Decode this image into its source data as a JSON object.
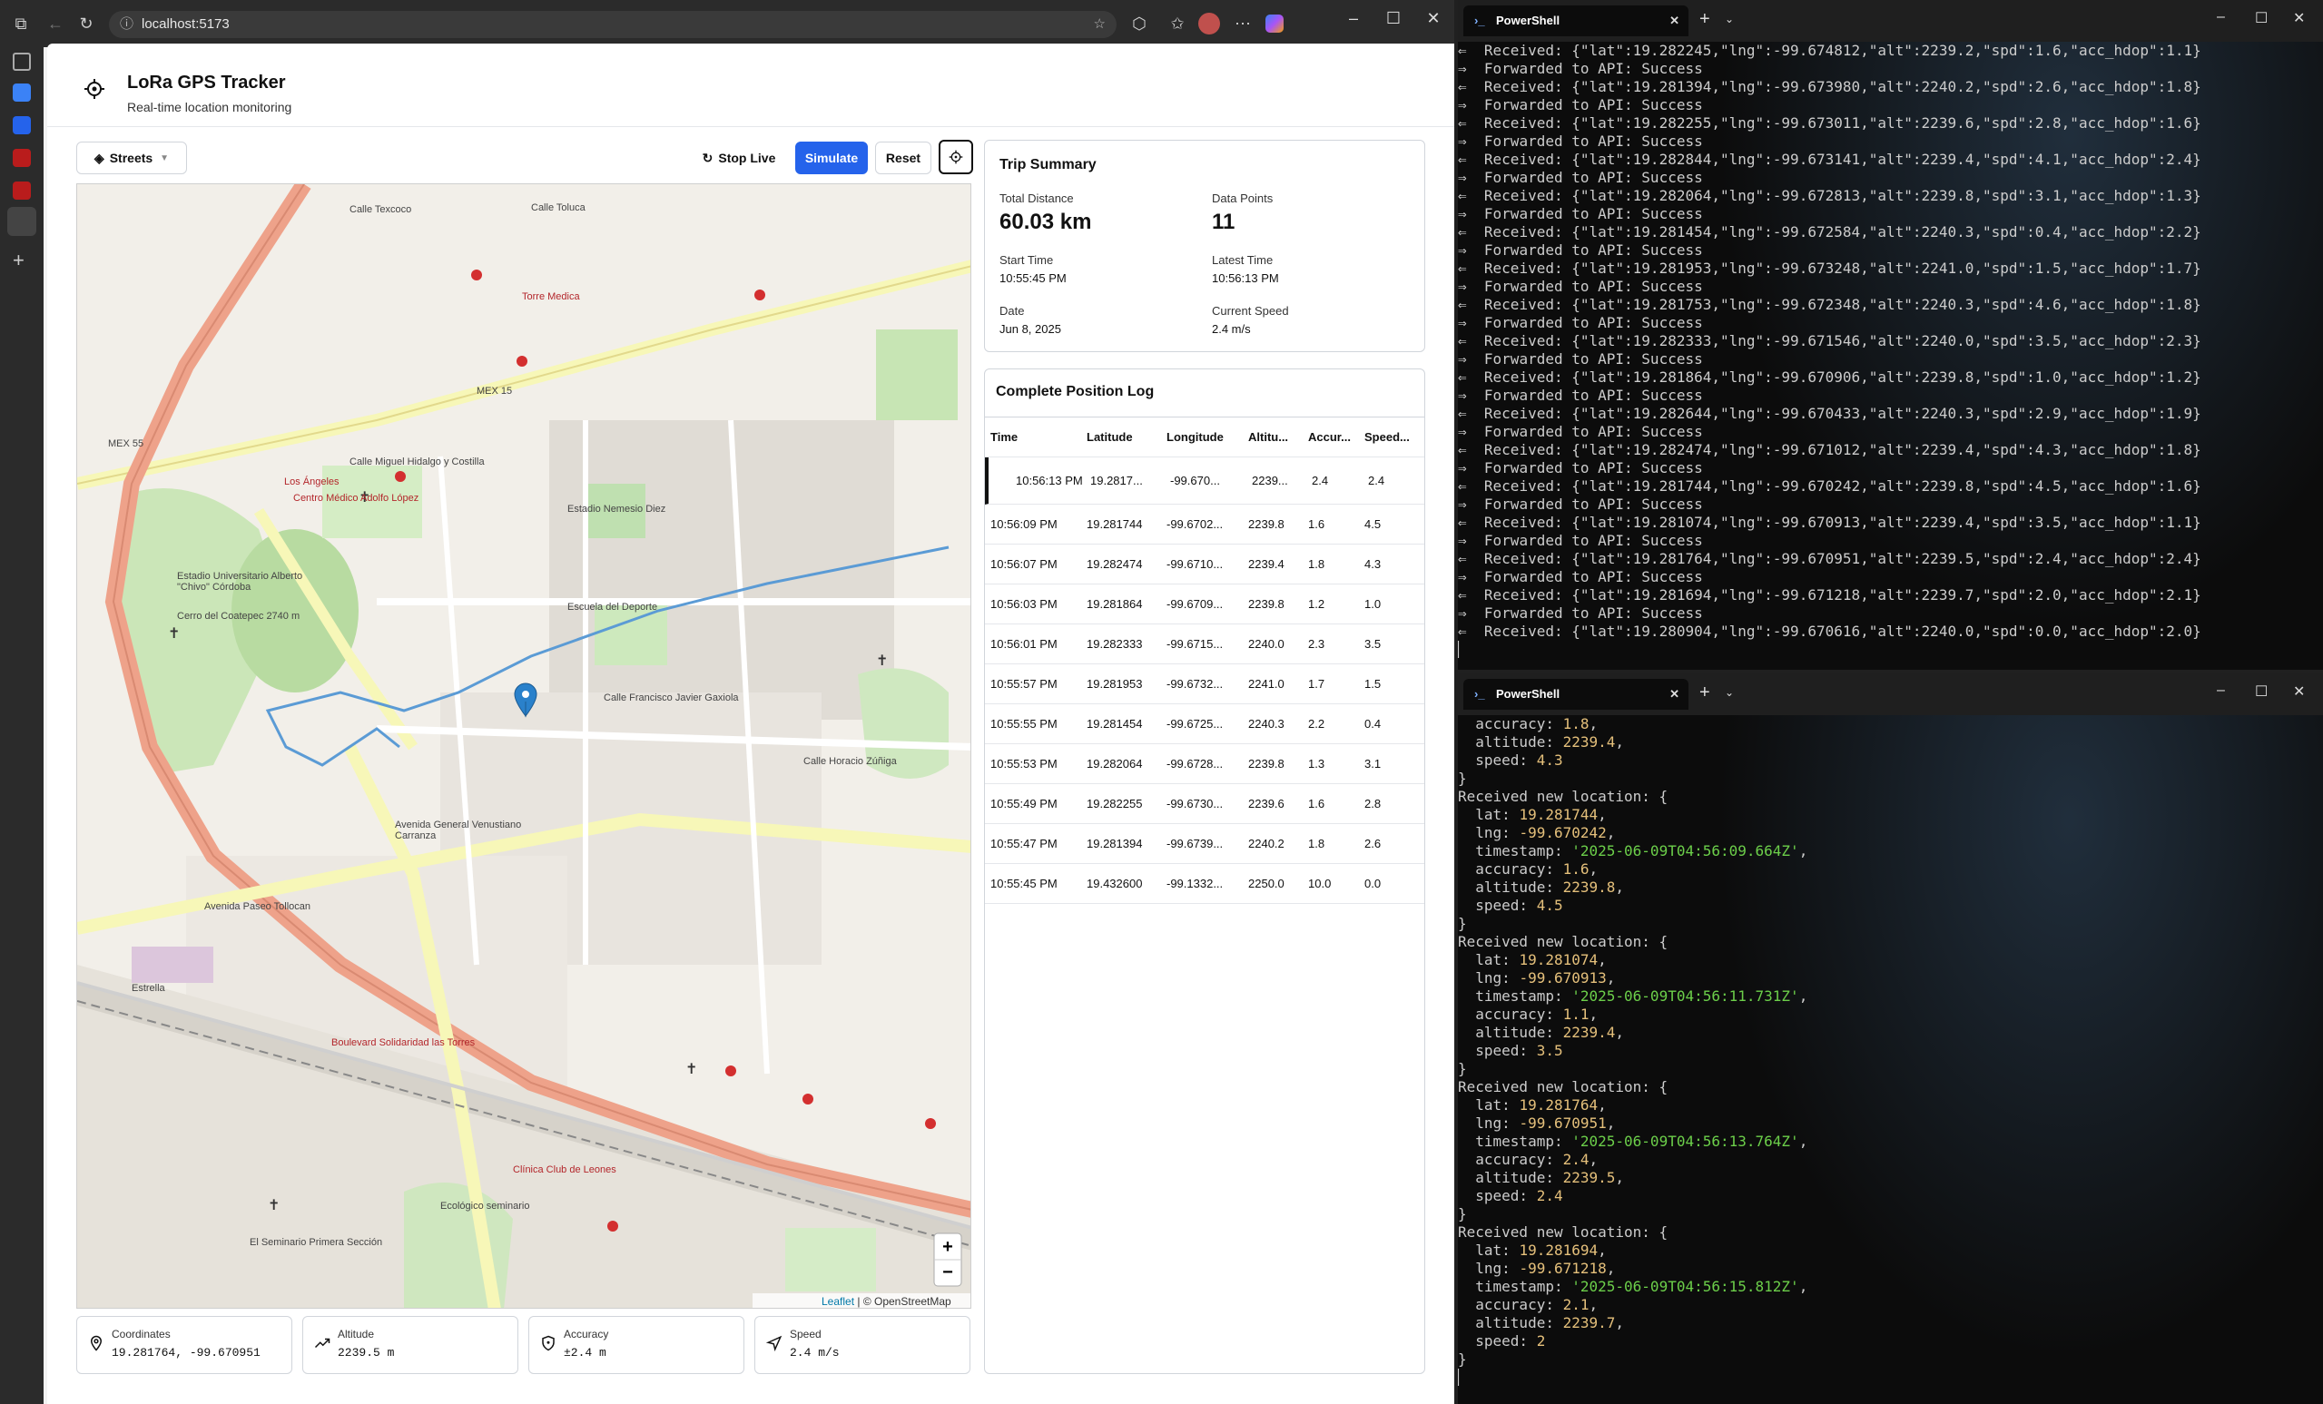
{
  "browser": {
    "url": "localhost:5173"
  },
  "app": {
    "title": "LoRa GPS Tracker",
    "subtitle": "Real-time location monitoring"
  },
  "toolbar": {
    "layer": "Streets",
    "stop_live": "Stop Live",
    "simulate": "Simulate",
    "reset": "Reset"
  },
  "map": {
    "attribution_leaflet": "Leaflet",
    "attribution_osm": "| © OpenStreetMap",
    "zoom_in": "+",
    "zoom_out": "−",
    "labels": [
      "Calle Texcoco",
      "Calle Toluca",
      "Torre Medica",
      "MEX 15",
      "MEX 55",
      "Los Ángeles",
      "Centro Médico Adolfo López",
      "Estadio Universitario Alberto \"Chivo\" Córdoba",
      "Estadio Nemesio Diez",
      "Escuela del Deporte",
      "Avenida General Venustiano Carranza",
      "Avenida Paseo Tollocan",
      "Boulevard Solidaridad las Torres",
      "Clínica Club de Leones",
      "El Seminario Primera Sección",
      "Ecológico seminario",
      "Estrella",
      "Cerro del Coatepec 2740 m",
      "Calle Horacio Zúñiga",
      "Calle Francisco Javier Gaxiola",
      "Calle Miguel Hidalgo y Costilla"
    ]
  },
  "stats": {
    "coordinates_label": "Coordinates",
    "coordinates": "19.281764, -99.670951",
    "altitude_label": "Altitude",
    "altitude": "2239.5 m",
    "accuracy_label": "Accuracy",
    "accuracy": "±2.4 m",
    "speed_label": "Speed",
    "speed": "2.4 m/s"
  },
  "trip": {
    "title": "Trip Summary",
    "total_distance_label": "Total Distance",
    "total_distance": "60.03 km",
    "data_points_label": "Data Points",
    "data_points": "11",
    "start_time_label": "Start Time",
    "start_time": "10:55:45 PM",
    "latest_time_label": "Latest Time",
    "latest_time": "10:56:13 PM",
    "date_label": "Date",
    "date": "Jun 8, 2025",
    "current_speed_label": "Current Speed",
    "current_speed": "2.4 m/s"
  },
  "log": {
    "title": "Complete Position Log",
    "headers": [
      "Time",
      "Latitude",
      "Longitude",
      "Altitu...",
      "Accur...",
      "Speed..."
    ],
    "rows": [
      [
        "10:56:13 PM",
        "19.2817...",
        "-99.670...",
        "2239...",
        "2.4",
        "2.4"
      ],
      [
        "10:56:09 PM",
        "19.281744",
        "-99.6702...",
        "2239.8",
        "1.6",
        "4.5"
      ],
      [
        "10:56:07 PM",
        "19.282474",
        "-99.6710...",
        "2239.4",
        "1.8",
        "4.3"
      ],
      [
        "10:56:03 PM",
        "19.281864",
        "-99.6709...",
        "2239.8",
        "1.2",
        "1.0"
      ],
      [
        "10:56:01 PM",
        "19.282333",
        "-99.6715...",
        "2240.0",
        "2.3",
        "3.5"
      ],
      [
        "10:55:57 PM",
        "19.281953",
        "-99.6732...",
        "2241.0",
        "1.7",
        "1.5"
      ],
      [
        "10:55:55 PM",
        "19.281454",
        "-99.6725...",
        "2240.3",
        "2.2",
        "0.4"
      ],
      [
        "10:55:53 PM",
        "19.282064",
        "-99.6728...",
        "2239.8",
        "1.3",
        "3.1"
      ],
      [
        "10:55:49 PM",
        "19.282255",
        "-99.6730...",
        "2239.6",
        "1.6",
        "2.8"
      ],
      [
        "10:55:47 PM",
        "19.281394",
        "-99.6739...",
        "2240.2",
        "1.8",
        "2.6"
      ],
      [
        "10:55:45 PM",
        "19.432600",
        "-99.1332...",
        "2250.0",
        "10.0",
        "0.0"
      ]
    ]
  },
  "term1": {
    "tab": "PowerShell",
    "lines": [
      "Received: {\"lat\":19.282245,\"lng\":-99.674812,\"alt\":2239.2,\"spd\":1.6,\"acc_hdop\":1.1}",
      "Forwarded to API: Success",
      "Received: {\"lat\":19.281394,\"lng\":-99.673980,\"alt\":2240.2,\"spd\":2.6,\"acc_hdop\":1.8}",
      "Forwarded to API: Success",
      "Received: {\"lat\":19.282255,\"lng\":-99.673011,\"alt\":2239.6,\"spd\":2.8,\"acc_hdop\":1.6}",
      "Forwarded to API: Success",
      "Received: {\"lat\":19.282844,\"lng\":-99.673141,\"alt\":2239.4,\"spd\":4.1,\"acc_hdop\":2.4}",
      "Forwarded to API: Success",
      "Received: {\"lat\":19.282064,\"lng\":-99.672813,\"alt\":2239.8,\"spd\":3.1,\"acc_hdop\":1.3}",
      "Forwarded to API: Success",
      "Received: {\"lat\":19.281454,\"lng\":-99.672584,\"alt\":2240.3,\"spd\":0.4,\"acc_hdop\":2.2}",
      "Forwarded to API: Success",
      "Received: {\"lat\":19.281953,\"lng\":-99.673248,\"alt\":2241.0,\"spd\":1.5,\"acc_hdop\":1.7}",
      "Forwarded to API: Success",
      "Received: {\"lat\":19.281753,\"lng\":-99.672348,\"alt\":2240.3,\"spd\":4.6,\"acc_hdop\":1.8}",
      "Forwarded to API: Success",
      "Received: {\"lat\":19.282333,\"lng\":-99.671546,\"alt\":2240.0,\"spd\":3.5,\"acc_hdop\":2.3}",
      "Forwarded to API: Success",
      "Received: {\"lat\":19.281864,\"lng\":-99.670906,\"alt\":2239.8,\"spd\":1.0,\"acc_hdop\":1.2}",
      "Forwarded to API: Success",
      "Received: {\"lat\":19.282644,\"lng\":-99.670433,\"alt\":2240.3,\"spd\":2.9,\"acc_hdop\":1.9}",
      "Forwarded to API: Success",
      "Received: {\"lat\":19.282474,\"lng\":-99.671012,\"alt\":2239.4,\"spd\":4.3,\"acc_hdop\":1.8}",
      "Forwarded to API: Success",
      "Received: {\"lat\":19.281744,\"lng\":-99.670242,\"alt\":2239.8,\"spd\":4.5,\"acc_hdop\":1.6}",
      "Forwarded to API: Success",
      "Received: {\"lat\":19.281074,\"lng\":-99.670913,\"alt\":2239.4,\"spd\":3.5,\"acc_hdop\":1.1}",
      "Forwarded to API: Success",
      "Received: {\"lat\":19.281764,\"lng\":-99.670951,\"alt\":2239.5,\"spd\":2.4,\"acc_hdop\":2.4}",
      "Forwarded to API: Success",
      "Received: {\"lat\":19.281694,\"lng\":-99.671218,\"alt\":2239.7,\"spd\":2.0,\"acc_hdop\":2.1}",
      "Forwarded to API: Success",
      "Received: {\"lat\":19.280904,\"lng\":-99.670616,\"alt\":2240.0,\"spd\":0.0,\"acc_hdop\":2.0}"
    ]
  },
  "term2": {
    "tab": "PowerShell",
    "lines": [
      {
        "k": "  accuracy: ",
        "v": "1.8",
        "t": "num",
        "end": ","
      },
      {
        "k": "  altitude: ",
        "v": "2239.4",
        "t": "num",
        "end": ","
      },
      {
        "k": "  speed: ",
        "v": "4.3",
        "t": "num",
        "end": ""
      },
      {
        "k": "}",
        "v": "",
        "t": "",
        "end": ""
      },
      {
        "k": "Received new location: {",
        "v": "",
        "t": "",
        "end": ""
      },
      {
        "k": "  lat: ",
        "v": "19.281744",
        "t": "num",
        "end": ","
      },
      {
        "k": "  lng: ",
        "v": "-99.670242",
        "t": "num",
        "end": ","
      },
      {
        "k": "  timestamp: ",
        "v": "'2025-06-09T04:56:09.664Z'",
        "t": "str",
        "end": ","
      },
      {
        "k": "  accuracy: ",
        "v": "1.6",
        "t": "num",
        "end": ","
      },
      {
        "k": "  altitude: ",
        "v": "2239.8",
        "t": "num",
        "end": ","
      },
      {
        "k": "  speed: ",
        "v": "4.5",
        "t": "num",
        "end": ""
      },
      {
        "k": "}",
        "v": "",
        "t": "",
        "end": ""
      },
      {
        "k": "Received new location: {",
        "v": "",
        "t": "",
        "end": ""
      },
      {
        "k": "  lat: ",
        "v": "19.281074",
        "t": "num",
        "end": ","
      },
      {
        "k": "  lng: ",
        "v": "-99.670913",
        "t": "num",
        "end": ","
      },
      {
        "k": "  timestamp: ",
        "v": "'2025-06-09T04:56:11.731Z'",
        "t": "str",
        "end": ","
      },
      {
        "k": "  accuracy: ",
        "v": "1.1",
        "t": "num",
        "end": ","
      },
      {
        "k": "  altitude: ",
        "v": "2239.4",
        "t": "num",
        "end": ","
      },
      {
        "k": "  speed: ",
        "v": "3.5",
        "t": "num",
        "end": ""
      },
      {
        "k": "}",
        "v": "",
        "t": "",
        "end": ""
      },
      {
        "k": "Received new location: {",
        "v": "",
        "t": "",
        "end": ""
      },
      {
        "k": "  lat: ",
        "v": "19.281764",
        "t": "num",
        "end": ","
      },
      {
        "k": "  lng: ",
        "v": "-99.670951",
        "t": "num",
        "end": ","
      },
      {
        "k": "  timestamp: ",
        "v": "'2025-06-09T04:56:13.764Z'",
        "t": "str",
        "end": ","
      },
      {
        "k": "  accuracy: ",
        "v": "2.4",
        "t": "num",
        "end": ","
      },
      {
        "k": "  altitude: ",
        "v": "2239.5",
        "t": "num",
        "end": ","
      },
      {
        "k": "  speed: ",
        "v": "2.4",
        "t": "num",
        "end": ""
      },
      {
        "k": "}",
        "v": "",
        "t": "",
        "end": ""
      },
      {
        "k": "Received new location: {",
        "v": "",
        "t": "",
        "end": ""
      },
      {
        "k": "  lat: ",
        "v": "19.281694",
        "t": "num",
        "end": ","
      },
      {
        "k": "  lng: ",
        "v": "-99.671218",
        "t": "num",
        "end": ","
      },
      {
        "k": "  timestamp: ",
        "v": "'2025-06-09T04:56:15.812Z'",
        "t": "str",
        "end": ","
      },
      {
        "k": "  accuracy: ",
        "v": "2.1",
        "t": "num",
        "end": ","
      },
      {
        "k": "  altitude: ",
        "v": "2239.7",
        "t": "num",
        "end": ","
      },
      {
        "k": "  speed: ",
        "v": "2",
        "t": "num",
        "end": ""
      },
      {
        "k": "}",
        "v": "",
        "t": "",
        "end": ""
      }
    ]
  },
  "colors": {
    "primary": "#2563eb",
    "track": "#5b9bd5",
    "terminal_bg": "#0c0c0c",
    "num": "#e5c07b",
    "str": "#6ccf4a"
  }
}
